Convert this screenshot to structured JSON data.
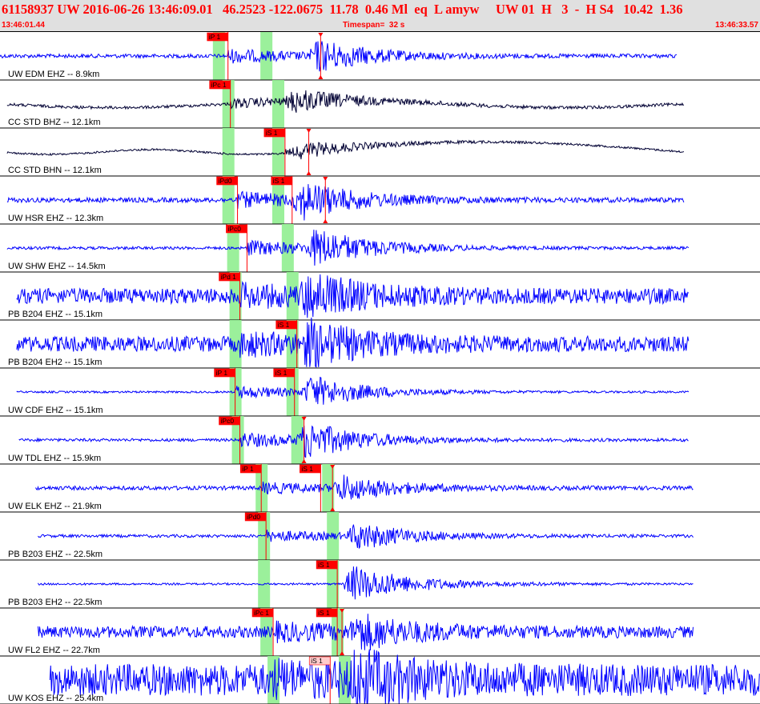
{
  "header": {
    "title": "61158937 UW 2016-06-26 13:46:09.01   46.2523 -122.0675  11.78  0.46 Ml  eq  L amyw     UW 01  H   3  -  H S4   10.42  1.36",
    "time_start": "13:46:01.44",
    "timespan": "Timespan=  32 s",
    "time_end": "13:46:33.57"
  },
  "colors": {
    "header_bg": "#e0e0e0",
    "header_text": "#ff0000",
    "trace_blue": "#0000ff",
    "trace_dark": "#000033",
    "pick_box": "#ff0000",
    "pick_box_light": "#ffcccc",
    "pick_line": "#ff0000",
    "theoretical_band": "#90ee90"
  },
  "chart_data": {
    "type": "line",
    "description_visible": "seismograms",
    "time_range": [
      0,
      32
    ],
    "panels": [
      {
        "label": "UW EDM EHZ -- 8.9km",
        "color": "#0000ff",
        "start": 0,
        "end": 28.5,
        "onset": 9.6,
        "s_onset": 13.0,
        "amp": 0.35,
        "noise": 0.04,
        "picks": [
          {
            "label": "iP 1",
            "t": 9.6,
            "style": "box"
          },
          {
            "label": "",
            "t": 13.5,
            "style": "marker"
          }
        ],
        "bands": [
          9.2,
          11.2
        ]
      },
      {
        "label": "CC STD BHZ -- 12.1km",
        "color": "#000033",
        "start": 0.3,
        "end": 28.8,
        "onset": 9.7,
        "s_onset": 12.0,
        "amp": 0.25,
        "noise": 0.03,
        "long_period": 0.25,
        "picks": [
          {
            "label": "iPc 1",
            "t": 9.7,
            "style": "box"
          }
        ],
        "bands": [
          9.6,
          11.7
        ]
      },
      {
        "label": "CC STD BHN -- 12.1km",
        "color": "#000033",
        "start": 0.3,
        "end": 28.8,
        "onset": 12.0,
        "s_onset": 12.3,
        "amp": 0.15,
        "noise": 0.02,
        "long_period": 0.0,
        "drift": 0.35,
        "picks": [
          {
            "label": "iS 1",
            "t": 12.0,
            "style": "box"
          },
          {
            "label": "",
            "t": 13.0,
            "style": "marker"
          }
        ],
        "bands": [
          9.6,
          11.7
        ]
      },
      {
        "label": "UW HSR EHZ -- 12.3km",
        "color": "#0000ff",
        "start": 0.3,
        "end": 28.8,
        "onset": 10.0,
        "s_onset": 12.3,
        "amp": 0.4,
        "noise": 0.05,
        "picks": [
          {
            "label": "iPd0",
            "t": 10.0,
            "style": "box"
          },
          {
            "label": "iS 1",
            "t": 12.3,
            "style": "box"
          },
          {
            "label": "",
            "t": 13.7,
            "style": "marker"
          }
        ],
        "bands": [
          9.6,
          11.7
        ]
      },
      {
        "label": "UW SHW EHZ -- 14.5km",
        "color": "#0000ff",
        "start": 0.3,
        "end": 29.0,
        "onset": 10.4,
        "s_onset": 12.9,
        "amp": 0.42,
        "noise": 0.03,
        "picks": [
          {
            "label": "iPc0",
            "t": 10.4,
            "style": "box"
          }
        ],
        "bands": [
          9.8,
          12.1
        ]
      },
      {
        "label": "PB B204 EHZ -- 15.1km",
        "color": "#0000ff",
        "start": 0.7,
        "end": 29.0,
        "onset": 10.1,
        "s_onset": 12.6,
        "amp": 0.42,
        "noise": 0.16,
        "picks": [
          {
            "label": "iPd 1",
            "t": 10.1,
            "style": "box"
          }
        ],
        "bands": [
          9.9,
          12.3
        ]
      },
      {
        "label": "PB B204 EH2 -- 15.1km",
        "color": "#0000ff",
        "start": 0.7,
        "end": 29.0,
        "onset": 10.1,
        "s_onset": 12.6,
        "amp": 0.42,
        "noise": 0.16,
        "picks": [
          {
            "label": "iS 1",
            "t": 12.5,
            "style": "box"
          }
        ],
        "bands": [
          9.9,
          12.3
        ]
      },
      {
        "label": "UW CDF EHZ -- 15.1km",
        "color": "#0000ff",
        "start": 0.7,
        "end": 29.0,
        "onset": 9.9,
        "s_onset": 12.7,
        "amp": 0.35,
        "noise": 0.02,
        "picks": [
          {
            "label": "iP 1",
            "t": 9.9,
            "style": "box"
          },
          {
            "label": "iS 1",
            "t": 12.4,
            "style": "box"
          }
        ],
        "bands": [
          9.9,
          12.3
        ]
      },
      {
        "label": "UW TDL EHZ -- 15.9km",
        "color": "#0000ff",
        "start": 0.8,
        "end": 29.0,
        "onset": 10.1,
        "s_onset": 12.5,
        "amp": 0.4,
        "noise": 0.03,
        "picks": [
          {
            "label": "iPc0",
            "t": 10.1,
            "style": "box"
          },
          {
            "label": "",
            "t": 12.8,
            "style": "marker"
          }
        ],
        "bands": [
          10.0,
          12.5
        ]
      },
      {
        "label": "UW ELK EHZ -- 21.9km",
        "color": "#0000ff",
        "start": 1.5,
        "end": 29.2,
        "onset": 11.0,
        "s_onset": 14.0,
        "amp": 0.28,
        "noise": 0.04,
        "picks": [
          {
            "label": "iP 1",
            "t": 11.0,
            "style": "box"
          },
          {
            "label": "iS 1",
            "t": 13.5,
            "style": "box"
          },
          {
            "label": "",
            "t": 14.0,
            "style": "marker"
          }
        ],
        "bands": [
          11.0,
          13.8
        ]
      },
      {
        "label": "PB B203 EHZ -- 22.5km",
        "color": "#0000ff",
        "start": 1.6,
        "end": 29.2,
        "onset": 11.2,
        "s_onset": 14.6,
        "amp": 0.3,
        "noise": 0.03,
        "picks": [
          {
            "label": "iPd0",
            "t": 11.2,
            "style": "box"
          }
        ],
        "bands": [
          11.1,
          14.0
        ]
      },
      {
        "label": "PB B203 EH2 -- 22.5km",
        "color": "#0000ff",
        "start": 1.6,
        "end": 29.2,
        "onset": 14.5,
        "s_onset": 14.5,
        "amp": 0.32,
        "noise": 0.02,
        "picks": [
          {
            "label": "iS 1",
            "t": 14.2,
            "style": "box"
          }
        ],
        "bands": [
          11.1,
          14.0
        ]
      },
      {
        "label": "UW FL2 EHZ -- 22.7km",
        "color": "#0000ff",
        "start": 1.6,
        "end": 29.2,
        "onset": 11.5,
        "s_onset": 14.7,
        "amp": 0.35,
        "noise": 0.12,
        "picks": [
          {
            "label": "iPc 1",
            "t": 11.5,
            "style": "box"
          },
          {
            "label": "iS 1",
            "t": 14.2,
            "style": "box"
          },
          {
            "label": "",
            "t": 14.4,
            "style": "marker"
          }
        ],
        "bands": [
          11.2,
          14.2
        ]
      },
      {
        "label": "UW KOS EHZ -- 25.4km",
        "color": "#0000ff",
        "start": 2.1,
        "end": 32.0,
        "onset": 11.5,
        "s_onset": 14.6,
        "amp": 0.45,
        "noise": 0.33,
        "picks": [
          {
            "label": "iS 1",
            "t": 13.9,
            "style": "lightbox"
          }
        ],
        "bands": [
          11.5,
          14.5
        ]
      }
    ]
  }
}
